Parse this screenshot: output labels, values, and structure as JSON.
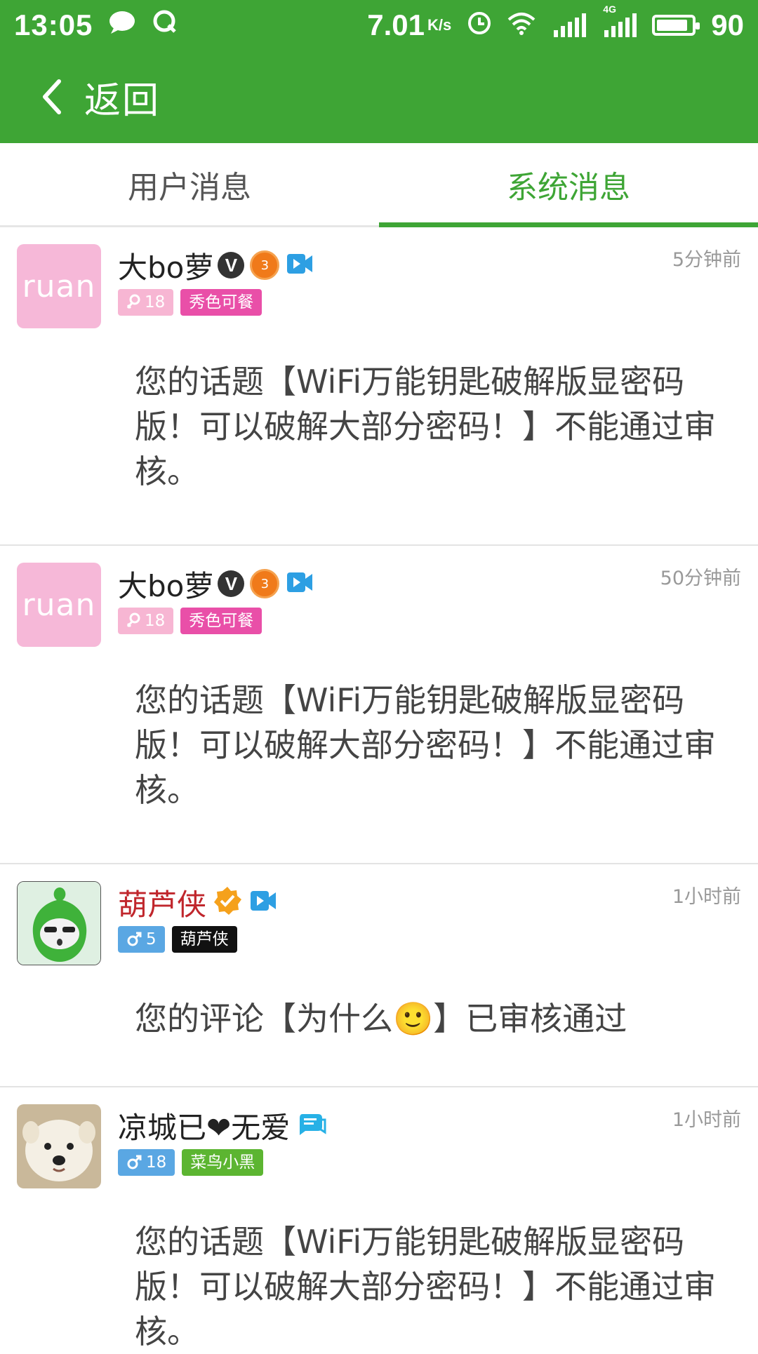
{
  "status_bar": {
    "time": "13:05",
    "speed": "7.01",
    "speed_unit": "K/s",
    "network": "4G",
    "battery": "90",
    "battery_level": 0.9
  },
  "app_bar": {
    "back_label": "返回"
  },
  "tabs": [
    {
      "label": "用户消息",
      "active": false
    },
    {
      "label": "系统消息",
      "active": true
    }
  ],
  "messages": [
    {
      "avatar_text": "ruan",
      "name": "大bo萝",
      "verified": "V",
      "medal": "3",
      "time": "5分钟前",
      "level": "18",
      "gender": "female",
      "title_tag": "秀色可餐",
      "text": "您的话题【WiFi万能钥匙破解版显密码版！可以破解大部分密码！】不能通过审核。"
    },
    {
      "avatar_text": "ruan",
      "name": "大bo萝",
      "verified": "V",
      "medal": "3",
      "time": "50分钟前",
      "level": "18",
      "gender": "female",
      "title_tag": "秀色可餐",
      "text": "您的话题【WiFi万能钥匙破解版显密码版！可以破解大部分密码！】不能通过审核。"
    },
    {
      "name": "葫芦侠",
      "time": "1小时前",
      "level": "5",
      "gender": "male",
      "title_tag": "葫芦侠",
      "text": "您的评论【为什么🙂】已审核通过"
    },
    {
      "name": "凉城已❤无爱",
      "time": "1小时前",
      "level": "18",
      "gender": "male",
      "title_tag": "菜鸟小黑",
      "text": "您的话题【WiFi万能钥匙破解版显密码版！可以破解大部分密码！】不能通过审核。"
    }
  ],
  "colors": {
    "brand_green": "#3ea535",
    "tag_pink": "#e94fa8",
    "tag_female": "#f7b6d3",
    "tag_male": "#5aa7e3",
    "tag_green": "#5cb531",
    "name_red": "#c0262c"
  },
  "icons": [
    "chat-icon",
    "q-icon",
    "alarm-icon",
    "wifi-icon",
    "signal-icon",
    "battery-icon",
    "back-arrow-icon",
    "verified-v-icon",
    "medal-icon",
    "video-icon",
    "verified-star-icon",
    "chat-bubble-icon",
    "female-icon",
    "male-icon"
  ]
}
